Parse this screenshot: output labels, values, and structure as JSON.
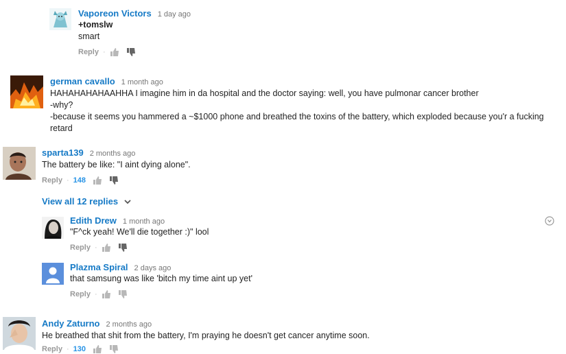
{
  "comments": [
    {
      "author": "Vaporeon Victors",
      "time": "1 day ago",
      "lines": [
        "+tomslw",
        "smart"
      ],
      "reply_label": "Reply",
      "likes": ""
    },
    {
      "author": "german cavallo",
      "time": "1 month ago",
      "lines": [
        "HAHAHAHAHAAHHA I imagine him in da hospital and the doctor saying: well, you have pulmonar cancer brother",
        "-why?",
        "-because it seems you hammered a ~$1000 phone and breathed the toxins of the battery, which exploded because you'r a fucking retard"
      ],
      "reply_label": "Reply",
      "likes": ""
    },
    {
      "author": "sparta139",
      "time": "2 months ago",
      "lines": [
        "The battery be like: \"I aint dying alone\"."
      ],
      "reply_label": "Reply",
      "likes": "148"
    },
    {
      "author": "Edith Drew",
      "time": "1 month ago",
      "lines": [
        "\"F^ck yeah! We'll die together :)\" lool"
      ],
      "reply_label": "Reply",
      "likes": ""
    },
    {
      "author": "Plazma Spiral",
      "time": "2 days ago",
      "lines": [
        "that samsung was like 'bitch my time aint up yet'"
      ],
      "reply_label": "Reply",
      "likes": ""
    },
    {
      "author": "Andy Zaturno",
      "time": "2 months ago",
      "lines": [
        "He breathed that shit from the battery, I'm praying he doesn't get cancer anytime soon."
      ],
      "reply_label": "Reply",
      "likes": "130"
    }
  ],
  "view_replies": "View all 12 replies",
  "colors": {
    "link": "#167ac6",
    "count": "#2793e6",
    "muted": "#999999"
  },
  "icons": [
    "thumbs-up-icon",
    "thumbs-down-icon",
    "chevron-down-icon",
    "menu-icon"
  ]
}
